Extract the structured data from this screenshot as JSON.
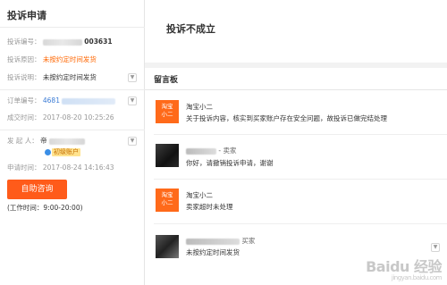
{
  "left": {
    "title": "投诉申请",
    "complaint_no_label": "投诉编号：",
    "complaint_no_suffix": "003631",
    "reason_label": "投诉原因：",
    "reason_value": "未按约定时间发货",
    "desc_label": "投诉说明：",
    "desc_value": "未按约定时间发货",
    "order_label": "订单编号：",
    "order_prefix": "4681",
    "deal_time_label": "成交时间：",
    "deal_time_value": "2017-08-20 10:25:26",
    "initiator_label": "发 起 人：",
    "initiator_value": "帝",
    "initiator_tag": "初级账户",
    "apply_time_label": "申请时间：",
    "apply_time_value": "2017-08-24 14:16:43",
    "consult_button": "自助咨询",
    "work_time": "(工作时间：9:00-20:00)"
  },
  "status": {
    "title": "投诉不成立"
  },
  "board": {
    "title": "留言板",
    "messages": [
      {
        "name": "淘宝小二",
        "role": "",
        "text": "关于投诉内容，核实到买家账户存在安全问题，故投诉已做完结处理",
        "avatar": "淘宝\n小二"
      },
      {
        "name": "",
        "role": "- 卖家",
        "text": "你好，请撤销投诉申请，谢谢",
        "avatar": ""
      },
      {
        "name": "淘宝小二",
        "role": "",
        "text": "卖家超时未处理",
        "avatar": "淘宝\n小二"
      },
      {
        "name": "",
        "role": "买家",
        "text": "未按约定时间发货",
        "avatar": ""
      }
    ],
    "tb_avatar_line1": "淘宝",
    "tb_avatar_line2": "小二"
  },
  "watermark": {
    "main": "Baidu 经验",
    "sub": "jingyan.baidu.com"
  },
  "icons": {
    "dropdown": "chevron-down-icon"
  }
}
